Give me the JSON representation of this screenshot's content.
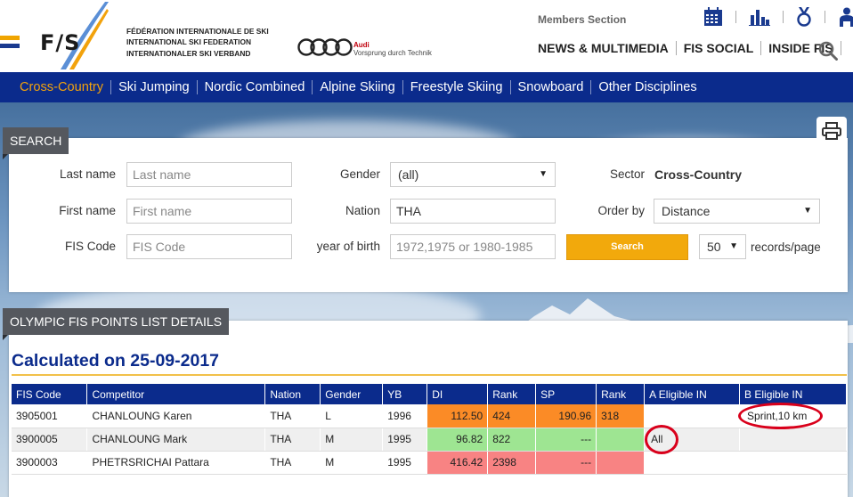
{
  "header": {
    "federation_lines": [
      "FÉDÉRATION INTERNATIONALE DE SKI",
      "INTERNATIONAL SKI FEDERATION",
      "INTERNATIONALER SKI VERBAND"
    ],
    "logo_text": "F/S",
    "audi_brand": "Audi",
    "audi_tagline": "Vorsprung durch Technik",
    "members_section": "Members Section",
    "main_links": [
      "NEWS & MULTIMEDIA",
      "FIS SOCIAL",
      "INSIDE FIS"
    ],
    "icons": [
      "calendar-icon",
      "bar-chart-icon",
      "medal-icon",
      "athlete-icon",
      "search-icon"
    ]
  },
  "nav": {
    "items": [
      "Cross-Country",
      "Ski Jumping",
      "Nordic Combined",
      "Alpine Skiing",
      "Freestyle Skiing",
      "Snowboard",
      "Other Disciplines"
    ],
    "active": "Cross-Country"
  },
  "search": {
    "title": "SEARCH",
    "last_name_label": "Last name",
    "last_name_placeholder": "Last name",
    "first_name_label": "First name",
    "first_name_placeholder": "First name",
    "fis_code_label": "FIS Code",
    "fis_code_placeholder": "FIS Code",
    "gender_label": "Gender",
    "gender_value": "(all)",
    "nation_label": "Nation",
    "nation_value": "THA",
    "yob_label": "year of birth",
    "yob_placeholder": "1972,1975 or 1980-1985",
    "sector_label": "Sector",
    "sector_value": "Cross-Country",
    "order_by_label": "Order by",
    "order_by_value": "Distance",
    "search_button": "Search",
    "records_value": "50",
    "records_label": "records/page"
  },
  "results": {
    "title": "OLYMPIC FIS POINTS LIST DETAILS",
    "calculated": "Calculated on 25-09-2017",
    "columns": [
      "FIS Code",
      "Competitor",
      "Nation",
      "Gender",
      "YB",
      "DI",
      "Rank",
      "SP",
      "Rank",
      "A Eligible IN",
      "B Eligible IN"
    ],
    "rows": [
      {
        "fis_code": "3905001",
        "competitor": "CHANLOUNG Karen",
        "nation": "THA",
        "gender": "L",
        "yb": "1996",
        "di": "112.50",
        "di_rank": "424",
        "sp": "190.96",
        "sp_rank": "318",
        "a_eligible": "",
        "b_eligible": "Sprint,10 km",
        "di_color": "#fb8b26",
        "sp_color": "#fb8b26"
      },
      {
        "fis_code": "3900005",
        "competitor": "CHANLOUNG Mark",
        "nation": "THA",
        "gender": "M",
        "yb": "1995",
        "di": "96.82",
        "di_rank": "822",
        "sp": "---",
        "sp_rank": "",
        "a_eligible": "All",
        "b_eligible": "",
        "di_color": "#9ee592",
        "sp_color": "#9ee592"
      },
      {
        "fis_code": "3900003",
        "competitor": "PHETRSRICHAI Pattara",
        "nation": "THA",
        "gender": "M",
        "yb": "1995",
        "di": "416.42",
        "di_rank": "2398",
        "sp": "---",
        "sp_rank": "",
        "a_eligible": "",
        "b_eligible": "",
        "di_color": "#f88383",
        "sp_color": "#f88383"
      }
    ]
  },
  "colors": {
    "nav_blue": "#0b2b8c",
    "active_orange": "#f2a20c",
    "search_button": "#f2a90c",
    "annotation_red": "#d9001b"
  }
}
